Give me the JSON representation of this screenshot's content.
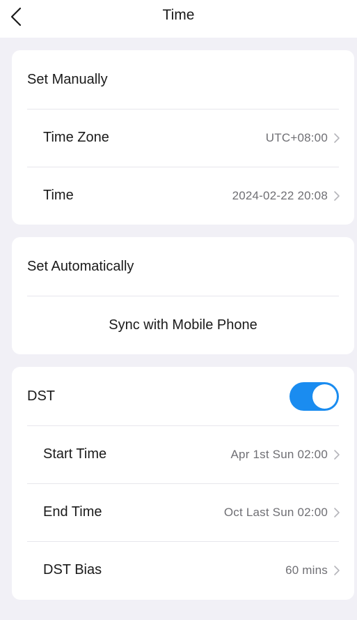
{
  "header": {
    "title": "Time",
    "back_icon": "chevron-left-icon"
  },
  "manual": {
    "title": "Set Manually",
    "rows": [
      {
        "label": "Time Zone",
        "value": "UTC+08:00"
      },
      {
        "label": "Time",
        "value": "2024-02-22 20:08"
      }
    ]
  },
  "automatic": {
    "title": "Set Automatically",
    "sync_label": "Sync with Mobile Phone"
  },
  "dst": {
    "title": "DST",
    "enabled": true,
    "toggle_color": "#1a8cf0",
    "rows": [
      {
        "label": "Start Time",
        "value": "Apr 1st Sun 02:00"
      },
      {
        "label": "End Time",
        "value": "Oct Last Sun 02:00"
      },
      {
        "label": "DST Bias",
        "value": "60 mins"
      }
    ]
  },
  "colors": {
    "background": "#f1f0f6",
    "card": "#ffffff",
    "accent": "#1a8cf0"
  }
}
